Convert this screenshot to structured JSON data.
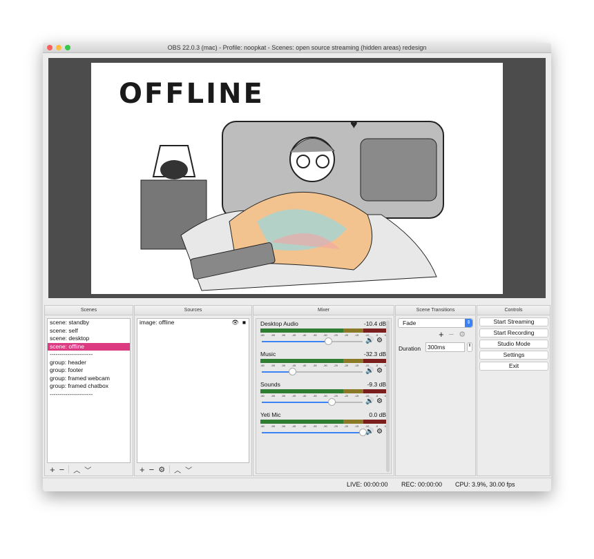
{
  "window": {
    "title": "OBS 22.0.3 (mac) - Profile: noopkat - Scenes: open source streaming (hidden areas) redesign"
  },
  "preview": {
    "image_text": "OFFLINE"
  },
  "scenes": {
    "title": "Scenes",
    "items": [
      "scene: standby",
      "scene: self",
      "scene: desktop",
      "scene: offline",
      "----------------------",
      "group: header",
      "group: footer",
      "group: framed webcam",
      "group: framed chatbox",
      "----------------------"
    ],
    "selected": 3
  },
  "sources": {
    "title": "Sources",
    "items": [
      {
        "label": "image: offline",
        "visible": true,
        "locked": true
      }
    ]
  },
  "mixer": {
    "title": "Mixer",
    "ticks": [
      "-60",
      "-55",
      "-50",
      "-45",
      "-40",
      "-35",
      "-30",
      "-25",
      "-20",
      "-15",
      "-10",
      "-5",
      "0"
    ],
    "channels": [
      {
        "name": "Desktop Audio",
        "db": "-10.4 dB",
        "volume": 0.66
      },
      {
        "name": "Music",
        "db": "-32.3 dB",
        "volume": 0.3
      },
      {
        "name": "Sounds",
        "db": "-9.3 dB",
        "volume": 0.69
      },
      {
        "name": "Yeti Mic",
        "db": "0.0 dB",
        "volume": 1.0
      }
    ]
  },
  "transitions": {
    "title": "Scene Transitions",
    "selected": "Fade",
    "duration_label": "Duration",
    "duration": "300ms"
  },
  "controls": {
    "title": "Controls",
    "buttons": [
      "Start Streaming",
      "Start Recording",
      "Studio Mode",
      "Settings",
      "Exit"
    ]
  },
  "status": {
    "live": "LIVE: 00:00:00",
    "rec": "REC: 00:00:00",
    "cpu": "CPU: 3.9%, 30.00 fps"
  },
  "colors": {
    "selection": "#dc3b82",
    "accent": "#3b82f6"
  }
}
